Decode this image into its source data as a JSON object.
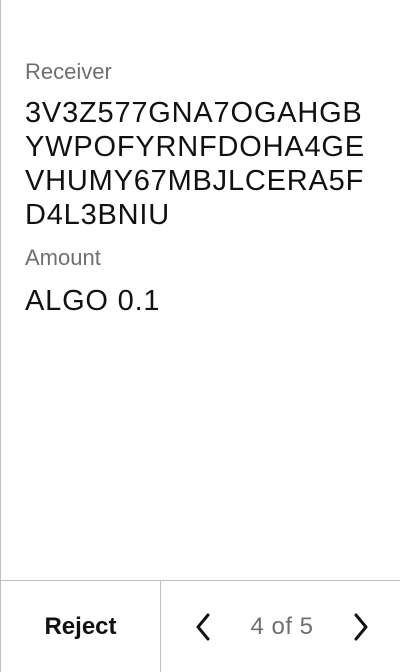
{
  "fields": {
    "receiver_label": "Receiver",
    "receiver_value": "3V3Z577GNA7OGAHGBYWPOFYRNFDOHA4GEVHUMY67MBJLCERA5FD4L3BNIU",
    "amount_label": "Amount",
    "amount_value": "ALGO 0.1"
  },
  "footer": {
    "reject_label": "Reject",
    "page_indicator": "4 of 5",
    "prev_icon": "chevron-left-icon",
    "next_icon": "chevron-right-icon"
  }
}
